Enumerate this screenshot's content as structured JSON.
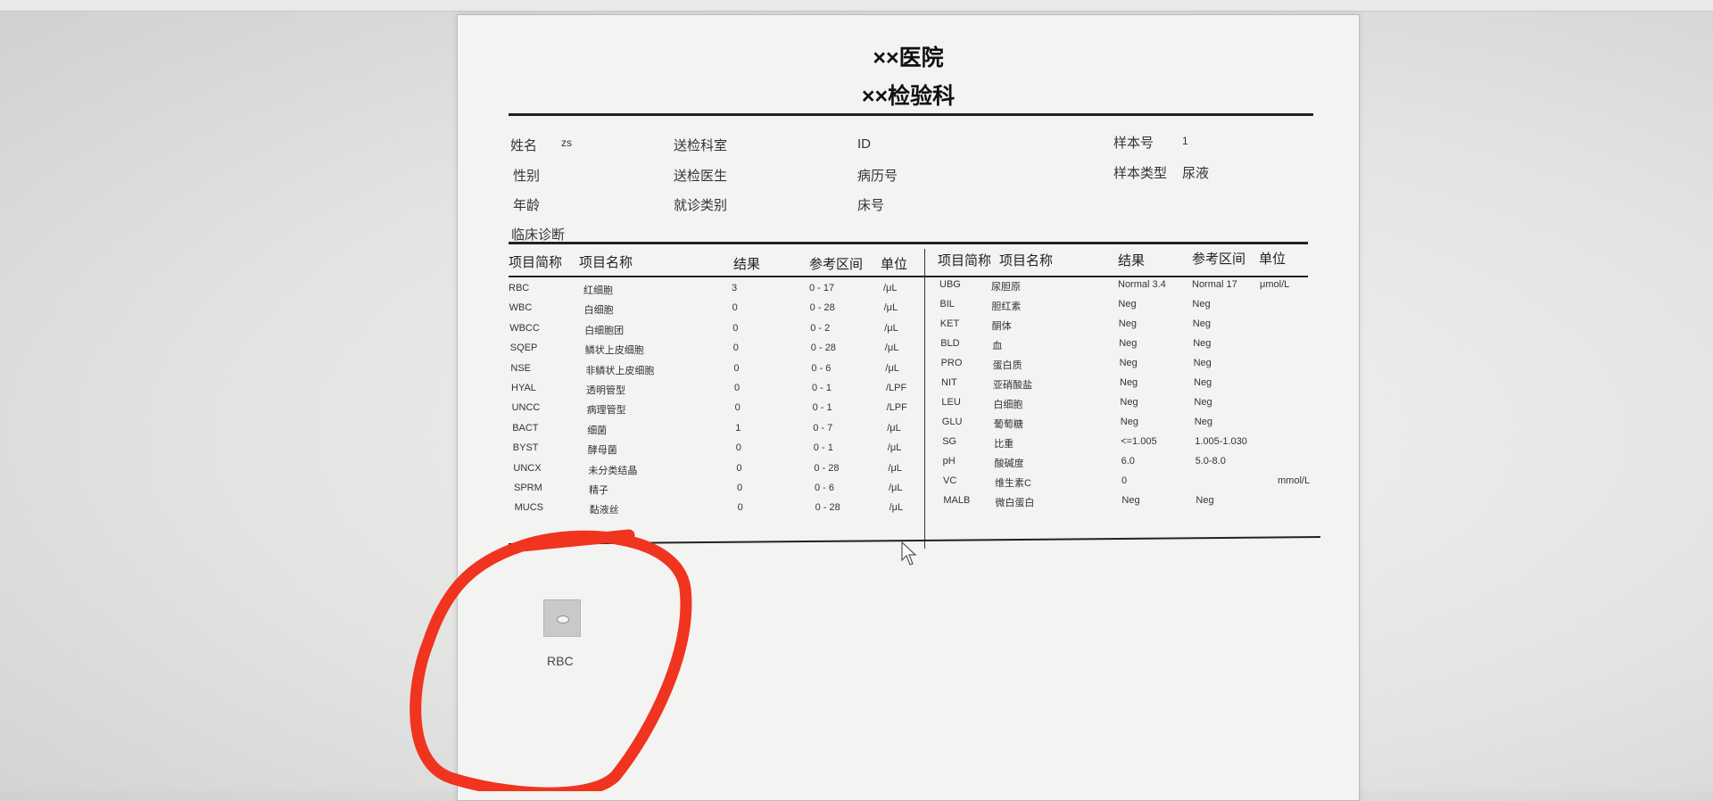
{
  "report": {
    "hospital": "××医院",
    "department": "××检验科",
    "info_labels": {
      "name": "姓名",
      "name_value": "zs",
      "send_dept": "送检科室",
      "id": "ID",
      "sample_no": "样本号",
      "sample_no_value": "1",
      "sex": "性别",
      "send_doctor": "送检医生",
      "record_no": "病历号",
      "sample_type": "样本类型",
      "sample_type_value": "尿液",
      "age": "年龄",
      "visit_type": "就诊类别",
      "bed_no": "床号",
      "diagnosis": "临床诊断"
    },
    "table_headers": {
      "abbr": "项目简称",
      "name": "项目名称",
      "result": "结果",
      "range": "参考区间",
      "unit": "单位"
    },
    "left_rows": [
      {
        "abbr": "RBC",
        "name": "红细胞",
        "result": "3",
        "range": "0 - 17",
        "unit": "/μL"
      },
      {
        "abbr": "WBC",
        "name": "白细胞",
        "result": "0",
        "range": "0 - 28",
        "unit": "/μL"
      },
      {
        "abbr": "WBCC",
        "name": "白细胞团",
        "result": "0",
        "range": "0 - 2",
        "unit": "/μL"
      },
      {
        "abbr": "SQEP",
        "name": "鳞状上皮细胞",
        "result": "0",
        "range": "0 - 28",
        "unit": "/μL"
      },
      {
        "abbr": "NSE",
        "name": "非鳞状上皮细胞",
        "result": "0",
        "range": "0 - 6",
        "unit": "/μL"
      },
      {
        "abbr": "HYAL",
        "name": "透明管型",
        "result": "0",
        "range": "0 - 1",
        "unit": "/LPF"
      },
      {
        "abbr": "UNCC",
        "name": "病理管型",
        "result": "0",
        "range": "0 - 1",
        "unit": "/LPF"
      },
      {
        "abbr": "BACT",
        "name": "细菌",
        "result": "1",
        "range": "0 - 7",
        "unit": "/μL"
      },
      {
        "abbr": "BYST",
        "name": "酵母菌",
        "result": "0",
        "range": "0 - 1",
        "unit": "/μL"
      },
      {
        "abbr": "UNCX",
        "name": "未分类结晶",
        "result": "0",
        "range": "0 - 28",
        "unit": "/μL"
      },
      {
        "abbr": "SPRM",
        "name": "精子",
        "result": "0",
        "range": "0 - 6",
        "unit": "/μL"
      },
      {
        "abbr": "MUCS",
        "name": "黏液丝",
        "result": "0",
        "range": "0 - 28",
        "unit": "/μL"
      }
    ],
    "right_rows": [
      {
        "abbr": "UBG",
        "name": "尿胆原",
        "result": "Normal  3.4",
        "range": "Normal  17",
        "unit": "μmol/L"
      },
      {
        "abbr": "BIL",
        "name": "胆红素",
        "result": "Neg",
        "range": "Neg",
        "unit": ""
      },
      {
        "abbr": "KET",
        "name": "酮体",
        "result": "Neg",
        "range": "Neg",
        "unit": ""
      },
      {
        "abbr": "BLD",
        "name": "血",
        "result": "Neg",
        "range": "Neg",
        "unit": ""
      },
      {
        "abbr": "PRO",
        "name": "蛋白质",
        "result": "Neg",
        "range": "Neg",
        "unit": ""
      },
      {
        "abbr": "NIT",
        "name": "亚硝酸盐",
        "result": "Neg",
        "range": "Neg",
        "unit": ""
      },
      {
        "abbr": "LEU",
        "name": "白细胞",
        "result": "Neg",
        "range": "Neg",
        "unit": ""
      },
      {
        "abbr": "GLU",
        "name": "葡萄糖",
        "result": "Neg",
        "range": "Neg",
        "unit": ""
      },
      {
        "abbr": "SG",
        "name": "比重",
        "result": "<=1.005",
        "range": "1.005-1.030",
        "unit": ""
      },
      {
        "abbr": "pH",
        "name": "酸碱度",
        "result": "6.0",
        "range": "5.0-8.0",
        "unit": ""
      },
      {
        "abbr": "VC",
        "name": "维生素C",
        "result": "0",
        "range": "",
        "unit": "mmol/L"
      },
      {
        "abbr": "MALB",
        "name": "微白蛋白",
        "result": "Neg",
        "range": "Neg",
        "unit": ""
      }
    ],
    "image_label": "RBC"
  },
  "colors": {
    "annotation_red": "#f0341f",
    "paper": "#f3f3f1"
  },
  "icons": {
    "cursor": "mouse-pointer-icon",
    "thumbnail": "rbc-cell-thumbnail-icon"
  }
}
